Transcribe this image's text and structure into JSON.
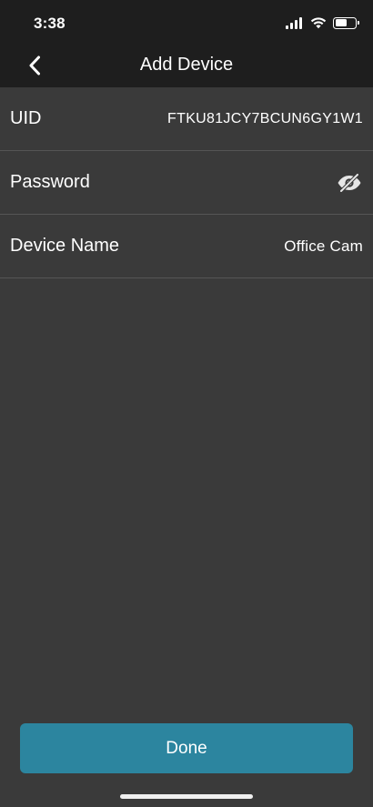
{
  "status_bar": {
    "time": "3:38",
    "icons": [
      "signal-icon",
      "wifi-icon",
      "battery-icon"
    ],
    "battery_level": 0.6
  },
  "nav": {
    "title": "Add Device",
    "back_icon": "chevron-left-icon"
  },
  "form": {
    "uid": {
      "label": "UID",
      "value": "FTKU81JCY7BCUN6GY1W1"
    },
    "password": {
      "label": "Password",
      "value": "",
      "toggle_icon": "eye-slash-icon"
    },
    "device_name": {
      "label": "Device Name",
      "value": "Office Cam"
    }
  },
  "actions": {
    "done_label": "Done"
  },
  "colors": {
    "background": "#3a3a3a",
    "bar_background": "#1e1e1e",
    "divider": "#555555",
    "accent": "#2c859f",
    "text": "#ffffff"
  }
}
